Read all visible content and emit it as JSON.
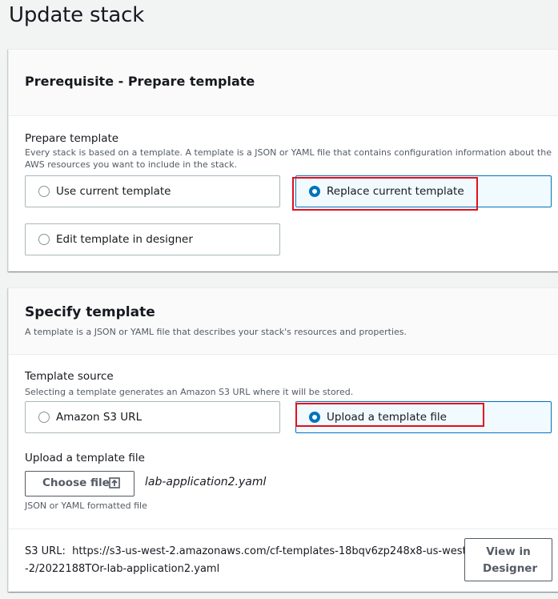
{
  "page": {
    "title": "Update stack"
  },
  "prerequisite": {
    "title": "Prerequisite - Prepare template",
    "field_label": "Prepare template",
    "field_desc": "Every stack is based on a template. A template is a JSON or YAML file that contains configuration information about the AWS resources you want to include in the stack.",
    "options": [
      {
        "label": "Use current template",
        "selected": false
      },
      {
        "label": "Replace current template",
        "selected": true
      },
      {
        "label": "Edit template in designer",
        "selected": false
      }
    ]
  },
  "specify": {
    "title": "Specify template",
    "desc": "A template is a JSON or YAML file that describes your stack's resources and properties.",
    "source_label": "Template source",
    "source_desc": "Selecting a template generates an Amazon S3 URL where it will be stored.",
    "options": [
      {
        "label": "Amazon S3 URL",
        "selected": false
      },
      {
        "label": "Upload a template file",
        "selected": true
      }
    ],
    "upload_label": "Upload a template file",
    "choose_file_label": "Choose file",
    "file_name": "lab-application2.yaml",
    "file_hint": "JSON or YAML formatted file",
    "s3_url_label": "S3 URL:",
    "s3_url_value": "https://s3-us-west-2.amazonaws.com/cf-templates-18bqv6zp248x8-us-west-2/2022188TOr-lab-application2.yaml",
    "view_designer_label": "View in Designer"
  },
  "colors": {
    "accent": "#0073bb",
    "highlight": "#e3101f",
    "selected_bg": "#f1faff"
  }
}
